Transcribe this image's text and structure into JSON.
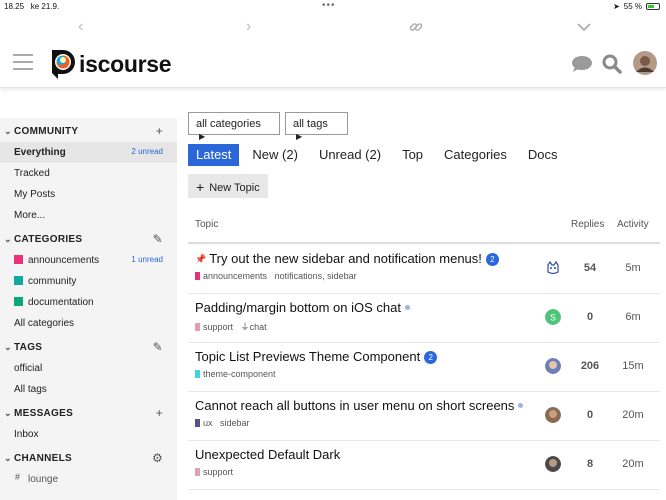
{
  "status": {
    "time": "18.25",
    "date": "ke 21.9.",
    "battery": "55 %"
  },
  "header": {
    "logo_text": "iscourse"
  },
  "sidebar": {
    "community": {
      "label": "COMMUNITY",
      "items": [
        {
          "label": "Everything",
          "badge": "2 unread"
        },
        {
          "label": "Tracked"
        },
        {
          "label": "My Posts"
        },
        {
          "label": "More..."
        }
      ]
    },
    "categories": {
      "label": "CATEGORIES",
      "items": [
        {
          "label": "announcements",
          "badge": "1 unread",
          "color": "#e8317a"
        },
        {
          "label": "community",
          "color": "#12a89d"
        },
        {
          "label": "documentation",
          "color": "#0ea67b"
        }
      ],
      "all": "All categories"
    },
    "tags": {
      "label": "TAGS",
      "items": [
        "official"
      ],
      "all": "All tags"
    },
    "messages": {
      "label": "MESSAGES",
      "items": [
        "Inbox"
      ]
    },
    "channels": {
      "label": "CHANNELS",
      "items": [
        "lounge"
      ]
    }
  },
  "filters": {
    "categories": "all categories",
    "tags": "all tags"
  },
  "nav": [
    "Latest",
    "New (2)",
    "Unread (2)",
    "Top",
    "Categories",
    "Docs"
  ],
  "new_topic": "New Topic",
  "table": {
    "headers": {
      "topic": "Topic",
      "replies": "Replies",
      "activity": "Activity"
    },
    "rows": [
      {
        "title": "Try out the new sidebar and notification menus!",
        "unread": "2",
        "category": "announcements",
        "category_color": "#e8317a",
        "tags": [
          "notifications",
          "sidebar"
        ],
        "replies": "54",
        "activity": "5m"
      },
      {
        "title": "Padding/margin bottom on iOS chat",
        "category": "support",
        "category_color": "#dca0ae",
        "tags": [
          "chat"
        ],
        "replies": "0",
        "activity": "6m"
      },
      {
        "title": "Topic List Previews Theme Component",
        "unread": "2",
        "category": "theme-component",
        "category_color": "#46d3e0",
        "tags": [],
        "replies": "206",
        "activity": "15m"
      },
      {
        "title": "Cannot reach all buttons in user menu on short screens",
        "category": "ux",
        "category_color": "#5b4e8a",
        "tags": [
          "sidebar"
        ],
        "replies": "0",
        "activity": "20m"
      },
      {
        "title": "Unexpected Default Dark",
        "category": "support",
        "category_color": "#dca0ae",
        "tags": [],
        "replies": "8",
        "activity": "20m"
      }
    ]
  },
  "colors": {
    "accent": "#2a68d9",
    "sidebar_bg": "#f4f4f4"
  }
}
